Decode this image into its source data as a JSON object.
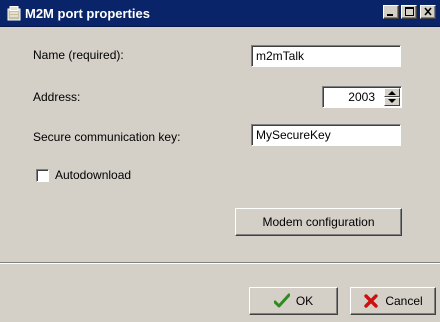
{
  "window": {
    "title": "M2M port properties",
    "icons": {
      "app": "document-icon",
      "minimize": "minimize-icon",
      "maximize": "maximize-icon",
      "close": "close-icon"
    }
  },
  "form": {
    "name_label": "Name (required):",
    "name_value": "m2mTalk",
    "address_label": "Address:",
    "address_value": "2003",
    "key_label": "Secure communication key:",
    "key_value": "MySecureKey",
    "autodownload_label": "Autodownload",
    "autodownload_checked": false,
    "modem_button": "Modem configuration"
  },
  "footer": {
    "ok_label": "OK",
    "cancel_label": "Cancel",
    "ok_icon": "checkmark-icon",
    "cancel_icon": "x-icon"
  },
  "colors": {
    "titlebar": "#0a246a",
    "face": "#d4d0c8",
    "ok_green": "#2e8b1e",
    "cancel_red": "#cc1010"
  }
}
